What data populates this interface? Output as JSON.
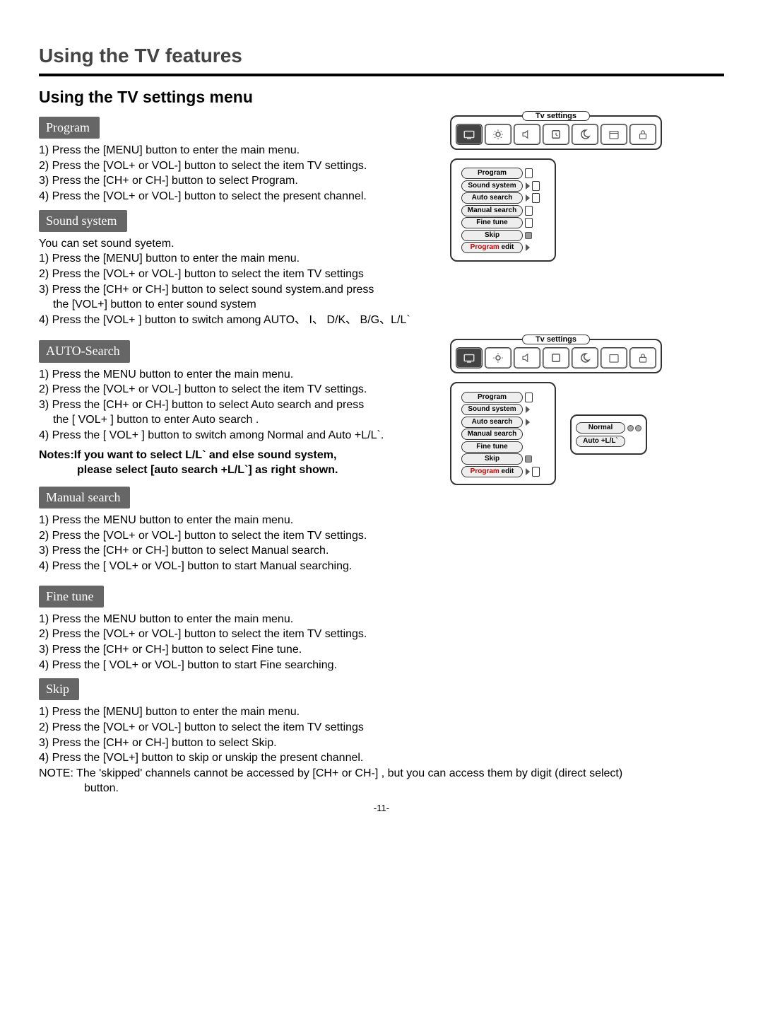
{
  "mainTitle": "Using the TV features",
  "subTitle": "Using the TV settings menu",
  "pageNumber": "-11-",
  "sections": {
    "program": {
      "label": "Program",
      "s1": "1) Press the [MENU] button to enter the main menu.",
      "s2": "2) Press the [VOL+ or VOL-] button to select the item TV settings.",
      "s3": "3) Press the [CH+ or CH-] button to select Program.",
      "s4": "4) Press the [VOL+ or VOL-] button  to select the present channel."
    },
    "sound": {
      "label": "Sound system",
      "intro": "You can set sound syetem.",
      "s1": "1) Press the [MENU] button to enter the main menu.",
      "s2": "2) Press the [VOL+ or VOL-] button to select the item TV settings",
      "s3": "3) Press the [CH+ or CH-] button to select sound system.and press",
      "s3b": "the [VOL+] button to enter sound system",
      "s4": "4) Press the [VOL+ ] button to switch among AUTO、 I、  D/K、 B/G、L/L`"
    },
    "auto": {
      "label": "AUTO-Search",
      "s1": "1) Press the MENU button to enter the main menu.",
      "s2": "2) Press the [VOL+ or VOL-] button to select the item TV settings.",
      "s3": "3) Press the [CH+ or CH-] button to select Auto search and press",
      "s3b": "the [ VOL+ ] button to enter Auto search .",
      "s4": "4) Press the  [ VOL+ ]  button to switch among  Normal and Auto +L/L`.",
      "note1": "Notes:If you want to select L/L` and else sound system,",
      "note2": "please select [auto search +L/L`] as right shown."
    },
    "manual": {
      "label": "Manual search",
      "s1": "1) Press the MENU button to enter the main menu.",
      "s2": "2) Press the [VOL+ or VOL-] button to select the item TV settings.",
      "s3": "3) Press the [CH+ or CH-] button to select Manual search.",
      "s4": "4) Press the  [ VOL+ or VOL-]  button to start Manual  searching."
    },
    "fine": {
      "label": "Fine tune",
      "s1": "1) Press the MENU button to enter the main menu.",
      "s2": "2) Press the [VOL+ or VOL-] button to select the item TV settings.",
      "s3": "3) Press the [CH+ or CH-] button to select Fine tune.",
      "s4": "4) Press the  [ VOL+ or VOL-]  button to start Fine searching."
    },
    "skip": {
      "label": "Skip",
      "s1": "1) Press the [MENU] button to enter the main menu.",
      "s2": "2) Press the [VOL+ or VOL-] button to select the item TV settings",
      "s3": "3) Press the [CH+ or CH-] button to select Skip.",
      "s4": "4) Press the [VOL+] button to skip or unskip  the present channel.",
      "note": "NOTE: The 'skipped' channels cannot be accessed by [CH+ or CH-] , but you can access them by digit (direct select)",
      "note2": "button."
    }
  },
  "osd": {
    "stripTitle": "Tv settings",
    "menu": {
      "program": "Program",
      "sound": "Sound system",
      "auto": "Auto search",
      "manual": "Manual search",
      "fine": "Fine tune",
      "skip": "Skip",
      "editPre": "Program",
      "editPost": " edit"
    },
    "sub": {
      "normal": "Normal",
      "autoL": "Auto +L/L`"
    }
  }
}
